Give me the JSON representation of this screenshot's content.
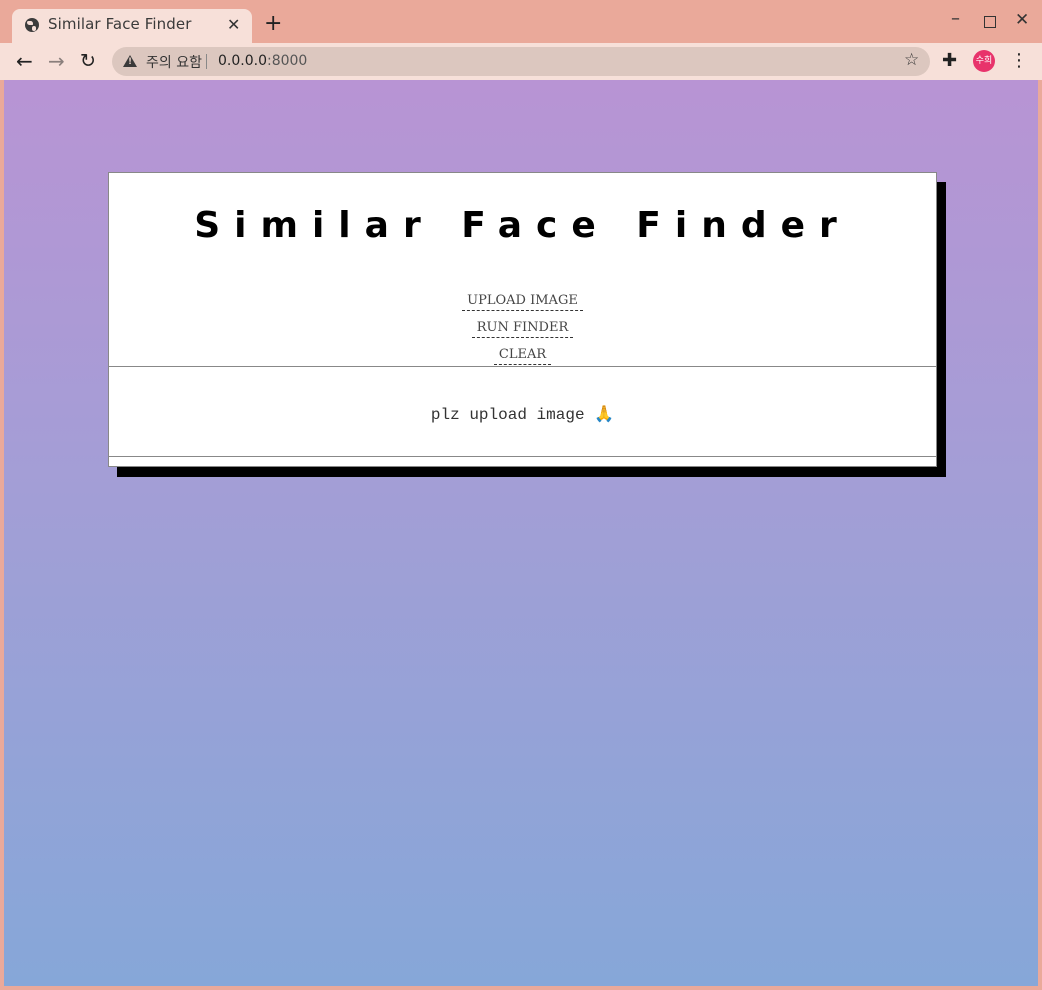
{
  "browser": {
    "tab_title": "Similar Face Finder",
    "tab_close": "✕",
    "new_tab": "+",
    "security_label": "주의 요함",
    "url_host": "0.0.0.0",
    "url_port": ":8000",
    "profile_initials": "수희",
    "icons": [
      "globe-icon",
      "back-arrow-icon",
      "forward-arrow-icon",
      "reload-icon",
      "warning-icon",
      "star-icon",
      "puzzle-icon",
      "kebab-menu-icon"
    ]
  },
  "page": {
    "title": "Similar Face Finder",
    "actions": {
      "upload": "UPLOAD IMAGE",
      "run": "RUN FINDER",
      "clear": "CLEAR"
    },
    "message": "plz upload image 🙏"
  },
  "colors": {
    "titlebar": "#eaa99a",
    "toolbar": "#f7e0d9",
    "gradient_top": "#b894d4",
    "gradient_bottom": "#86a7d8",
    "avatar": "#e8336b"
  }
}
